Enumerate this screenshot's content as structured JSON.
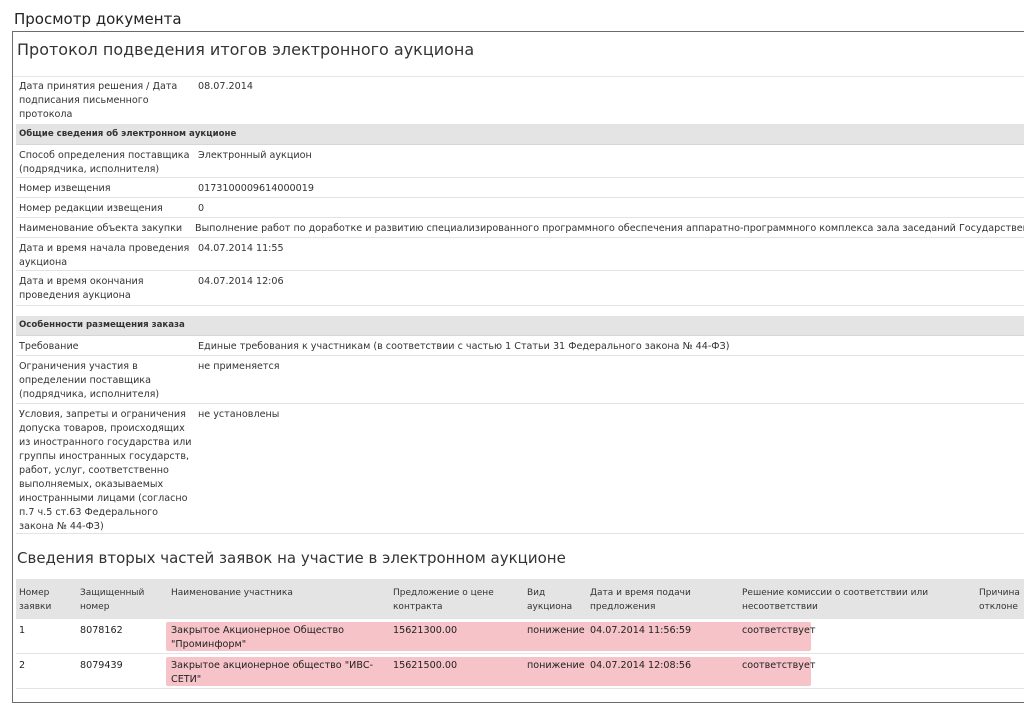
{
  "page_title": "Просмотр документа",
  "protocol": {
    "title": "Протокол подведения итогов электронного аукциона",
    "rows": [
      {
        "label": "Дата принятия решения / Дата подписания письменного протокола",
        "value": "08.07.2014"
      },
      {
        "section": "Общие сведения об электронном аукционе"
      },
      {
        "label": "Способ определения поставщика (подрядчика, исполнителя)",
        "value": "Электронный аукцион"
      },
      {
        "label": "Номер извещения",
        "value": "0173100009614000019"
      },
      {
        "label": "Номер редакции извещения",
        "value": "0"
      },
      {
        "label": "Наименование объекта закупки",
        "value": "Выполнение работ по доработке и развитию специализированного программного обеспечения аппаратно-программного комплекса зала заседаний Государственной Д"
      },
      {
        "label": "Дата и время начала проведения аукциона",
        "value": "04.07.2014 11:55"
      },
      {
        "label": "Дата и время окончания проведения аукциона",
        "value": "04.07.2014 12:06"
      },
      {
        "section": "Особенности размещения заказа"
      },
      {
        "label": "Требование",
        "value": "Единые требования к участникам (в соответствии с частью 1 Статьи 31 Федерального закона № 44-ФЗ)"
      },
      {
        "label": "Ограничения участия в определении поставщика (подрядчика, исполнителя)",
        "value": "не применяется"
      },
      {
        "label": "Условия, запреты и ограничения допуска товаров, происходящих из иностранного государства или группы иностранных государств, работ, услуг, соответственно выполняемых, оказываемых иностранными лицами (согласно п.7 ч.5 ст.63 Федерального закона № 44-ФЗ)",
        "value": "не установлены"
      }
    ]
  },
  "bids_section": {
    "title": "Сведения вторых частей заявок на участие в электронном аукционе",
    "columns": {
      "num": "Номер заявки",
      "code": "Защищенный номер",
      "name": "Наименование участника",
      "price": "Предложение о цене контракта",
      "kind": "Вид аукциона",
      "time": "Дата и время подачи предложения",
      "decision": "Решение комиссии о соответствии или несоответствии",
      "reason": "Причина отклоне"
    },
    "rows": [
      {
        "num": "1",
        "code": "8078162",
        "name": "Закрытое Акционерное Общество \"Проминформ\"",
        "price": "15621300.00",
        "kind": "понижение",
        "time": "04.07.2014 11:56:59",
        "decision": "соответствует"
      },
      {
        "num": "2",
        "code": "8079439",
        "name": "Закрытое акционерное общество \"ИВС-СЕТИ\"",
        "price": "15621500.00",
        "kind": "понижение",
        "time": "04.07.2014 12:08:56",
        "decision": "соответствует"
      }
    ]
  },
  "colors": {
    "highlight": "#f6c3c9",
    "header_bg": "#e4e4e4",
    "border": "#6b6b6b"
  }
}
